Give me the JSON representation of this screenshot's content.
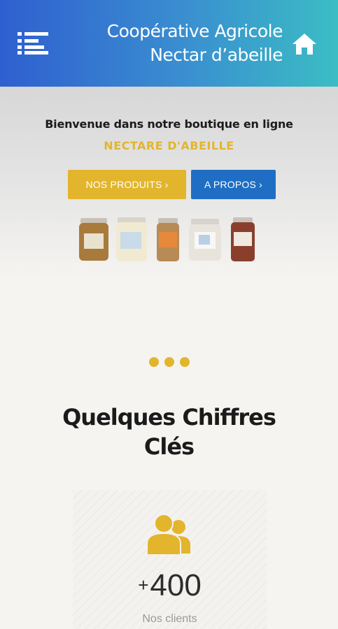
{
  "header": {
    "title_line1": "Coopérative Agricole",
    "title_line2": "Nectar d’abeille",
    "menu_icon": "menu-icon",
    "home_icon": "home-icon"
  },
  "hero": {
    "welcome": "Bienvenue dans notre boutique en ligne",
    "brand": "NECTARE D'ABEILLE",
    "buttons": {
      "products": "NOS PRODUITS ›",
      "about": "A PROPOS ›"
    },
    "image": "product-jars"
  },
  "section": {
    "title": "Quelques Chiffres Clés"
  },
  "stats": {
    "clients": {
      "prefix": "+",
      "value": "400",
      "label": "Nos clients",
      "icon": "users-icon"
    }
  },
  "colors": {
    "accent_gold": "#e3b52c",
    "accent_blue": "#1f6ec4",
    "header_gradient_start": "#2f5fd0",
    "header_gradient_end": "#3bbdc4"
  }
}
